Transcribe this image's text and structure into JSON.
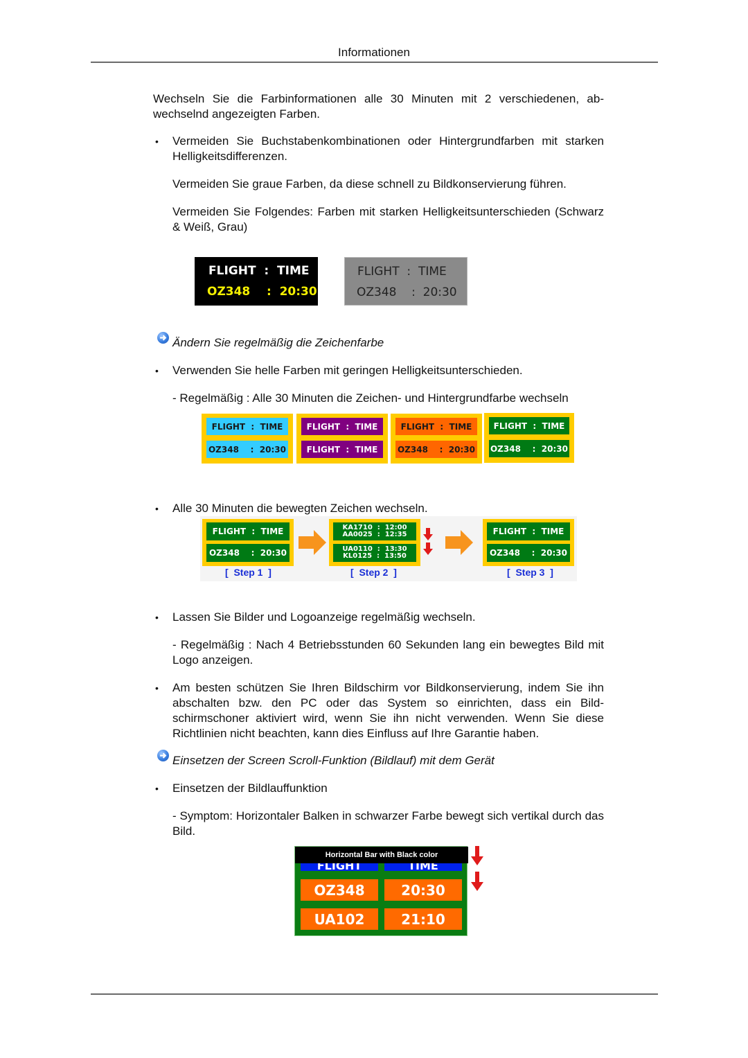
{
  "header": {
    "title": "Informationen"
  },
  "paragraphs": {
    "intro": "Wechseln Sie die Farbinformationen alle 30 Minuten mit 2 verschiedenen, ab­wechselnd angezeigten Farben.",
    "bullet1": "Vermeiden Sie Buchstabenkombinationen oder Hintergrundfarben mit starken Helligkeitsdifferenzen.",
    "bullet1_sub1": "Vermeiden Sie graue Farben, da diese schnell zu Bildkonservierung führen.",
    "bullet1_sub2": "Vermeiden Sie Folgendes: Farben mit starken Helligkeitsunterschieden (Schwarz & Weiß, Grau)",
    "heading1": "Ändern Sie regelmäßig die Zeichenfarbe",
    "bullet2": "Verwenden Sie helle Farben mit geringen Helligkeitsunterschieden.",
    "bullet2_sub1": "- Regelmäßig : Alle 30 Minuten die Zeichen- und Hintergrundfarbe wechseln",
    "bullet3": "Alle 30 Minuten die bewegten Zeichen wechseln.",
    "bullet4": "Lassen Sie Bilder und Logoanzeige regelmäßig wechseln.",
    "bullet4_sub1": "- Regelmäßig : Nach 4 Betriebsstunden 60 Sekunden lang ein bewegtes Bild mit Logo anzeigen.",
    "bullet5": "Am besten schützen Sie Ihren Bildschirm vor Bildkonservierung, indem Sie ihn abschalten bzw. den PC oder das System so einrichten, dass ein Bild­schirmschoner aktiviert wird, wenn Sie ihn nicht verwenden. Wenn Sie diese Richtlinien nicht beachten, kann dies Einfluss auf Ihre Garantie haben.",
    "heading2": "Einsetzen der Screen Scroll-Funktion (Bildlauf) mit dem Gerät",
    "bullet6": "Einsetzen der Bildlauffunktion",
    "bullet6_sub1": "- Symptom: Horizontaler Balken in schwarzer Farbe bewegt sich vertikal durch das Bild."
  },
  "bullet_char": "•",
  "contrast_boards": [
    {
      "line1": "FLIGHT  :  TIME",
      "line2": "OZ348    :  20:30",
      "bg": "#000000",
      "fg1": "#ffffff",
      "fg2": "#f4f000"
    },
    {
      "line1": "FLIGHT  :  TIME",
      "line2": "OZ348    :  20:30",
      "bg": "#8a8a8a",
      "fg1": "#222222",
      "fg2": "#222222"
    }
  ],
  "color_tiles": [
    {
      "row1": "FLIGHT  :  TIME",
      "row2": "OZ348    :  20:30",
      "bg": "#33ccff",
      "fg": "#1a1a1a"
    },
    {
      "row1": "FLIGHT  :  TIME",
      "row2": "FLIGHT  :  TIME",
      "bg": "#800080",
      "fg": "#ffffff"
    },
    {
      "row1": "FLIGHT  :  TIME",
      "row2": "OZ348    :  20:30",
      "bg": "#ff6600",
      "fg": "#1a1a1a"
    },
    {
      "row1": "FLIGHT  :  TIME",
      "row2": "OZ348    :  20:30",
      "bg": "#007a14",
      "fg": "#ffffff"
    }
  ],
  "steps": [
    {
      "label": "[  Step 1  ]",
      "row1": "FLIGHT  :  TIME",
      "row2": "OZ348    :  20:30"
    },
    {
      "label": "[  Step 2  ]",
      "row1a": "KA1710  :  12:00",
      "row1b": "AA0025  :  12:35",
      "row2a": "UA0110  :  13:30",
      "row2b": "KL0125  :  13:50"
    },
    {
      "label": "[  Step 3  ]",
      "row1": "FLIGHT  :  TIME",
      "row2": "OZ348    :  20:30"
    }
  ],
  "scroll_figure": {
    "bar_label": "Horizontal Bar with Black color",
    "head": [
      "FLIGHT",
      "TIME"
    ],
    "rows": [
      [
        "OZ348",
        "20:30"
      ],
      [
        "UA102",
        "21:10"
      ]
    ]
  }
}
